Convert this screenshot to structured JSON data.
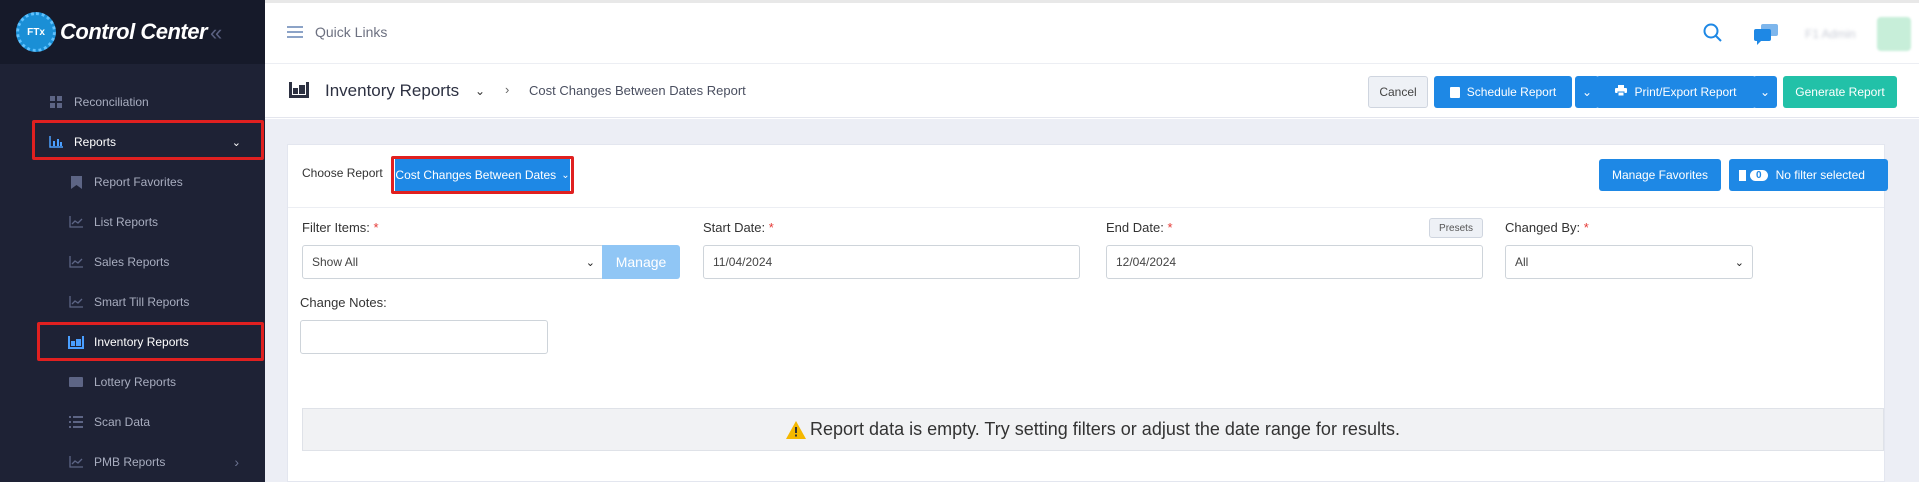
{
  "brand": {
    "title": "Control Center",
    "logo_text": "FTx"
  },
  "sidebar": {
    "items": [
      {
        "label": "Reconciliation",
        "icon": "grid-icon",
        "level": "top",
        "active": false
      },
      {
        "label": "Reports",
        "icon": "bar-chart-icon",
        "level": "top",
        "active": true,
        "highlighted": true
      },
      {
        "label": "Report Favorites",
        "icon": "bookmark-icon",
        "level": "sub",
        "active": false
      },
      {
        "label": "List Reports",
        "icon": "line-chart-icon",
        "level": "sub",
        "active": false
      },
      {
        "label": "Sales Reports",
        "icon": "line-chart-icon",
        "level": "sub",
        "active": false
      },
      {
        "label": "Smart Till Reports",
        "icon": "line-chart-icon",
        "level": "sub",
        "active": false
      },
      {
        "label": "Inventory Reports",
        "icon": "inventory-icon",
        "level": "sub",
        "active": true,
        "highlighted": true
      },
      {
        "label": "Lottery Reports",
        "icon": "ticket-icon",
        "level": "sub",
        "active": false
      },
      {
        "label": "Scan Data",
        "icon": "list-icon",
        "level": "sub",
        "active": false
      },
      {
        "label": "PMB Reports",
        "icon": "line-chart-icon",
        "level": "sub",
        "active": false
      }
    ]
  },
  "topbar": {
    "quick_links": "Quick Links",
    "user_name": "F1 Admin"
  },
  "header": {
    "title": "Inventory Reports",
    "breadcrumb": "Cost Changes Between Dates Report",
    "cancel": "Cancel",
    "schedule": "Schedule Report",
    "print_export": "Print/Export Report",
    "generate": "Generate Report"
  },
  "report": {
    "choose_label": "Choose Report",
    "selected_report": "Cost Changes Between Dates",
    "manage_favorites": "Manage Favorites",
    "filter_badge": "0",
    "filter_status": "No filter selected"
  },
  "filters": {
    "filter_items_label": "Filter Items:",
    "filter_items_value": "Show All",
    "manage": "Manage",
    "start_date_label": "Start Date:",
    "start_date_value": "11/04/2024",
    "end_date_label": "End Date:",
    "end_date_value": "12/04/2024",
    "presets": "Presets",
    "changed_by_label": "Changed By:",
    "changed_by_value": "All",
    "change_notes_label": "Change Notes:",
    "change_notes_value": "",
    "required_mark": "*"
  },
  "empty_message": "Report data is empty. Try setting filters or adjust the date range for results.",
  "colors": {
    "sidebar_bg": "#1e2235",
    "primary": "#1e88e5",
    "success": "#22c1a8",
    "highlight": "#e02020",
    "warning": "#f5b800"
  }
}
